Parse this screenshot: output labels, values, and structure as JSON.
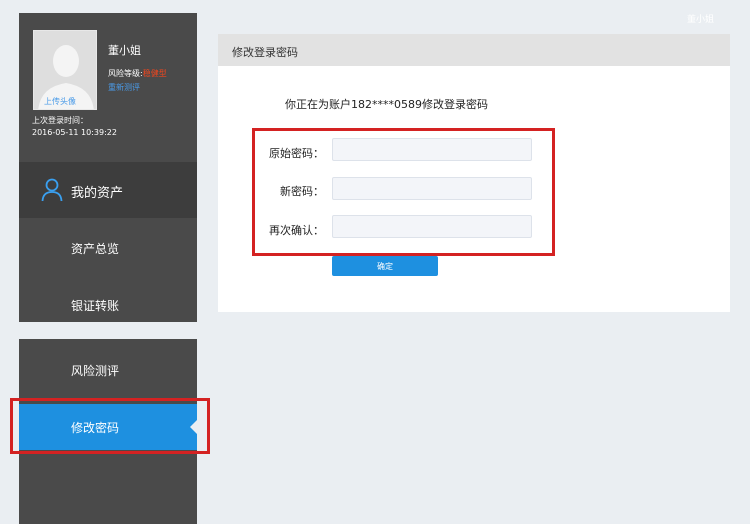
{
  "header": {
    "user_name": "董小姐"
  },
  "profile": {
    "upload_avatar": "上传头像",
    "name": "董小姐",
    "risk_label": "风险等级:",
    "risk_value": "稳健型",
    "retest": "重新测评",
    "last_login_label": "上次登录时间：",
    "last_login_time": "2016-05-11 10:39:22"
  },
  "sidebar": {
    "my_assets": "我的资产",
    "items": [
      {
        "label": "资产总览"
      },
      {
        "label": "银证转账"
      },
      {
        "label": "风险测评"
      },
      {
        "label": "修改密码",
        "active": true
      }
    ]
  },
  "main": {
    "title": "修改登录密码",
    "notice": "你正在为账户182****0589修改登录密码",
    "fields": [
      {
        "label": "原始密码：",
        "value": ""
      },
      {
        "label": "新密码：",
        "value": ""
      },
      {
        "label": "再次确认：",
        "value": ""
      }
    ],
    "submit_label": "确定"
  },
  "colors": {
    "accent": "#1e90e0",
    "sidebar_bg": "#4a4a4a",
    "risk_value": "#f0461e",
    "highlight_box": "#d42222"
  },
  "icons": [
    "default-avatar-icon",
    "person-icon",
    "active-arrow-icon"
  ]
}
